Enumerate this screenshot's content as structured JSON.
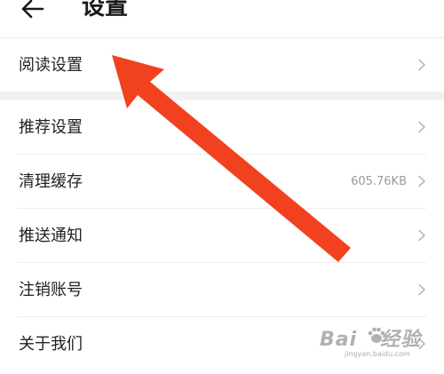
{
  "header": {
    "title": "设置",
    "back_icon": "arrow-left-icon"
  },
  "settings": {
    "reading": {
      "label": "阅读设置"
    },
    "items": [
      {
        "label": "推荐设置",
        "value": ""
      },
      {
        "label": "清理缓存",
        "value": "605.76KB"
      },
      {
        "label": "推送通知",
        "value": ""
      },
      {
        "label": "注销账号",
        "value": ""
      },
      {
        "label": "关于我们",
        "value": ""
      }
    ]
  },
  "annotation": {
    "arrow_color": "#f2411f"
  },
  "watermark": {
    "logo_left": "Bai",
    "logo_right": "经验",
    "sub": "jingyan.baidu.com"
  },
  "colors": {
    "background": "#ffffff",
    "group_gap": "#f2f2f2",
    "divider": "#ededed",
    "text": "#222222",
    "secondary_text": "#9a9a9a",
    "chevron": "#b8b8b8"
  }
}
